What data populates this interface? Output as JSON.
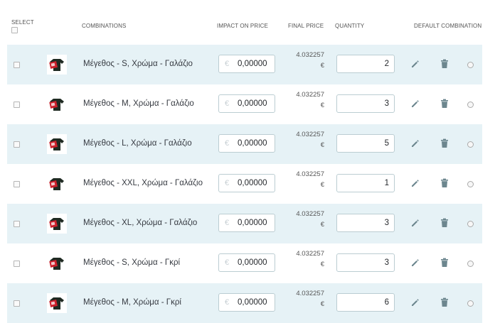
{
  "header": {
    "select": "SELECT",
    "combinations": "COMBINATIONS",
    "impact_on_price": "IMPACT ON PRICE",
    "final_price": "FINAL PRICE",
    "quantity": "QUANTITY",
    "default_combination": "DEFAULT COMBINATION"
  },
  "currency_symbol": "€",
  "icons": {
    "thumbnail": "product-thumbnail-icon",
    "edit": "pencil-icon",
    "delete": "trash-icon"
  },
  "colors": {
    "row_highlight": "#e6f2f6",
    "icon": "#6c868e",
    "input_border": "#bbcdd2"
  },
  "rows": [
    {
      "name": "Μέγεθος - S, Χρώμα - Γαλάζιο",
      "impact": "0,00000",
      "final_price": "4.032257",
      "final_currency": "€",
      "quantity": "2"
    },
    {
      "name": "Μέγεθος - M, Χρώμα - Γαλάζιο",
      "impact": "0,00000",
      "final_price": "4.032257",
      "final_currency": "€",
      "quantity": "3"
    },
    {
      "name": "Μέγεθος - L, Χρώμα - Γαλάζιο",
      "impact": "0,00000",
      "final_price": "4.032257",
      "final_currency": "€",
      "quantity": "5"
    },
    {
      "name": "Μέγεθος - XXL, Χρώμα - Γαλάζιο",
      "impact": "0,00000",
      "final_price": "4.032257",
      "final_currency": "€",
      "quantity": "1"
    },
    {
      "name": "Μέγεθος - XL, Χρώμα - Γαλάζιο",
      "impact": "0,00000",
      "final_price": "4.032257",
      "final_currency": "€",
      "quantity": "3"
    },
    {
      "name": "Μέγεθος - S, Χρώμα - Γκρί",
      "impact": "0,00000",
      "final_price": "4.032257",
      "final_currency": "€",
      "quantity": "3"
    },
    {
      "name": "Μέγεθος - M, Χρώμα - Γκρί",
      "impact": "0,00000",
      "final_price": "4.032257",
      "final_currency": "€",
      "quantity": "6"
    }
  ]
}
